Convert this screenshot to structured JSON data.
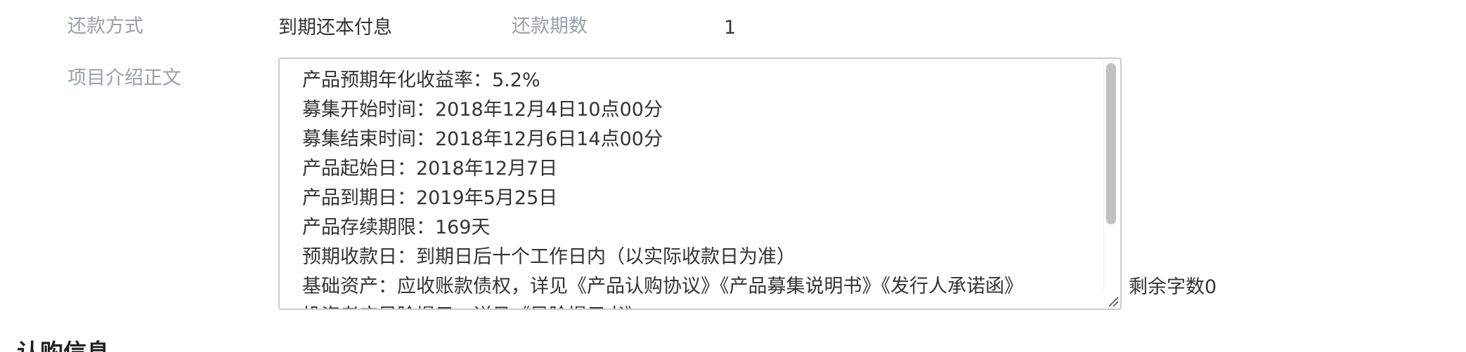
{
  "repayment": {
    "method_label": "还款方式",
    "method_value": "到期还本付息",
    "periods_label": "还款期数",
    "periods_value": "1"
  },
  "intro": {
    "label": "项目介绍正文",
    "lines": [
      "产品预期年化收益率：5.2%",
      "募集开始时间：2018年12月4日10点00分",
      "募集结束时间：2018年12月6日14点00分",
      "产品起始日：2018年12月7日",
      "产品到期日：2019年5月25日",
      "产品存续期限：169天",
      "预期收款日：到期日后十个工作日内（以实际收款日为准）",
      "基础资产：应收账款债权，详见《产品认购协议》《产品募集说明书》《发行人承诺函》",
      "投资者应风险提示，详见《风险提示书》"
    ],
    "remaining_chars": "剩余字数0"
  },
  "section": {
    "heading": "认购信息"
  },
  "icons": {
    "resize_handle": "resize-grip-icon"
  }
}
